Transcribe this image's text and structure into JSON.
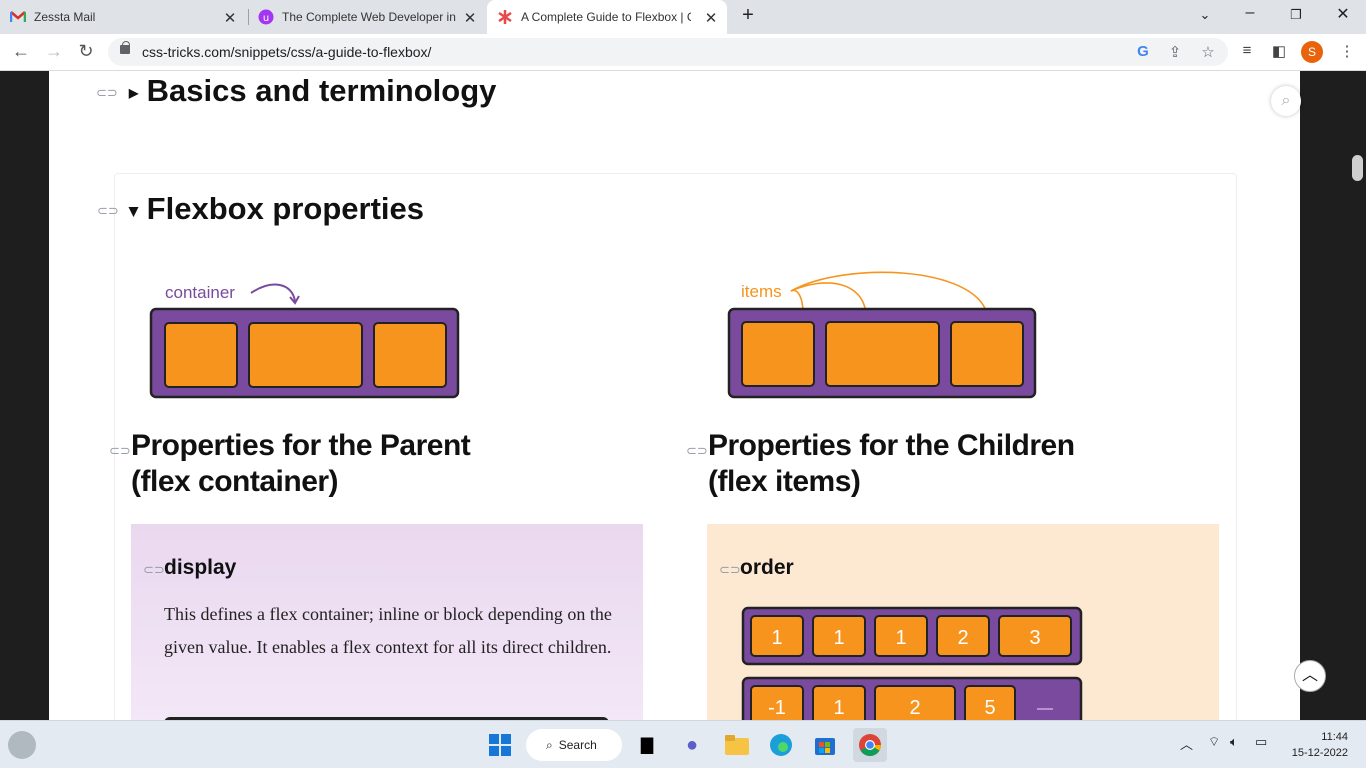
{
  "browser": {
    "tabs": [
      {
        "title": "Zessta Mail",
        "icon": "gmail-icon"
      },
      {
        "title": "The Complete Web Developer in",
        "icon": "udemy-icon"
      },
      {
        "title": "A Complete Guide to Flexbox | CSS-Tricks",
        "icon": "css-tricks-icon"
      }
    ],
    "url": "css-tricks.com/snippets/css/a-guide-to-flexbox/",
    "profile_initial": "S"
  },
  "page": {
    "basics_heading": "Basics and terminology",
    "basics_toggle": "▸",
    "flexbox_heading": "Flexbox properties",
    "flexbox_toggle": "▾",
    "diagram_container_label": "container",
    "diagram_items_label": "items",
    "parent_heading_1": "Properties for the Parent",
    "parent_heading_2": "(flex container)",
    "children_heading_1": "Properties for the Children",
    "children_heading_2": "(flex items)",
    "display_title": "display",
    "display_text": "This defines a flex container; inline or block depending on the given value. It enables a flex context for all its direct children.",
    "order_title": "order",
    "order_row1": [
      "1",
      "1",
      "1",
      "2",
      "3"
    ],
    "order_row2": [
      "-1",
      "1",
      "2",
      "5"
    ]
  },
  "colors": {
    "purple": "#7a4a9e",
    "orange": "#f7941d",
    "parent_panel_top": "#ead8ef",
    "child_panel": "#fde8d2"
  },
  "taskbar": {
    "search_label": "Search",
    "time": "11:44",
    "date": "15-12-2022"
  }
}
